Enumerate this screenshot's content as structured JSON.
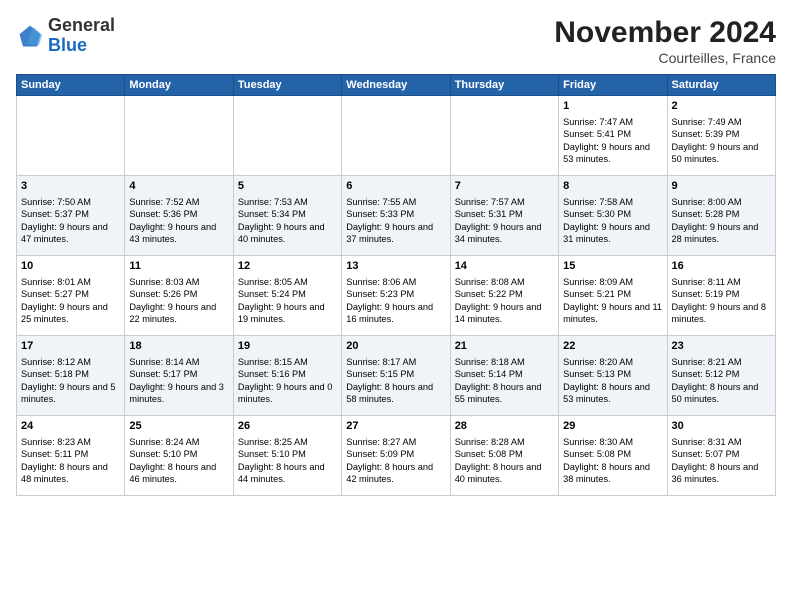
{
  "header": {
    "logo_general": "General",
    "logo_blue": "Blue",
    "month_title": "November 2024",
    "location": "Courteilles, France"
  },
  "weekdays": [
    "Sunday",
    "Monday",
    "Tuesday",
    "Wednesday",
    "Thursday",
    "Friday",
    "Saturday"
  ],
  "weeks": [
    [
      {
        "day": "",
        "info": ""
      },
      {
        "day": "",
        "info": ""
      },
      {
        "day": "",
        "info": ""
      },
      {
        "day": "",
        "info": ""
      },
      {
        "day": "",
        "info": ""
      },
      {
        "day": "1",
        "info": "Sunrise: 7:47 AM\nSunset: 5:41 PM\nDaylight: 9 hours and 53 minutes."
      },
      {
        "day": "2",
        "info": "Sunrise: 7:49 AM\nSunset: 5:39 PM\nDaylight: 9 hours and 50 minutes."
      }
    ],
    [
      {
        "day": "3",
        "info": "Sunrise: 7:50 AM\nSunset: 5:37 PM\nDaylight: 9 hours and 47 minutes."
      },
      {
        "day": "4",
        "info": "Sunrise: 7:52 AM\nSunset: 5:36 PM\nDaylight: 9 hours and 43 minutes."
      },
      {
        "day": "5",
        "info": "Sunrise: 7:53 AM\nSunset: 5:34 PM\nDaylight: 9 hours and 40 minutes."
      },
      {
        "day": "6",
        "info": "Sunrise: 7:55 AM\nSunset: 5:33 PM\nDaylight: 9 hours and 37 minutes."
      },
      {
        "day": "7",
        "info": "Sunrise: 7:57 AM\nSunset: 5:31 PM\nDaylight: 9 hours and 34 minutes."
      },
      {
        "day": "8",
        "info": "Sunrise: 7:58 AM\nSunset: 5:30 PM\nDaylight: 9 hours and 31 minutes."
      },
      {
        "day": "9",
        "info": "Sunrise: 8:00 AM\nSunset: 5:28 PM\nDaylight: 9 hours and 28 minutes."
      }
    ],
    [
      {
        "day": "10",
        "info": "Sunrise: 8:01 AM\nSunset: 5:27 PM\nDaylight: 9 hours and 25 minutes."
      },
      {
        "day": "11",
        "info": "Sunrise: 8:03 AM\nSunset: 5:26 PM\nDaylight: 9 hours and 22 minutes."
      },
      {
        "day": "12",
        "info": "Sunrise: 8:05 AM\nSunset: 5:24 PM\nDaylight: 9 hours and 19 minutes."
      },
      {
        "day": "13",
        "info": "Sunrise: 8:06 AM\nSunset: 5:23 PM\nDaylight: 9 hours and 16 minutes."
      },
      {
        "day": "14",
        "info": "Sunrise: 8:08 AM\nSunset: 5:22 PM\nDaylight: 9 hours and 14 minutes."
      },
      {
        "day": "15",
        "info": "Sunrise: 8:09 AM\nSunset: 5:21 PM\nDaylight: 9 hours and 11 minutes."
      },
      {
        "day": "16",
        "info": "Sunrise: 8:11 AM\nSunset: 5:19 PM\nDaylight: 9 hours and 8 minutes."
      }
    ],
    [
      {
        "day": "17",
        "info": "Sunrise: 8:12 AM\nSunset: 5:18 PM\nDaylight: 9 hours and 5 minutes."
      },
      {
        "day": "18",
        "info": "Sunrise: 8:14 AM\nSunset: 5:17 PM\nDaylight: 9 hours and 3 minutes."
      },
      {
        "day": "19",
        "info": "Sunrise: 8:15 AM\nSunset: 5:16 PM\nDaylight: 9 hours and 0 minutes."
      },
      {
        "day": "20",
        "info": "Sunrise: 8:17 AM\nSunset: 5:15 PM\nDaylight: 8 hours and 58 minutes."
      },
      {
        "day": "21",
        "info": "Sunrise: 8:18 AM\nSunset: 5:14 PM\nDaylight: 8 hours and 55 minutes."
      },
      {
        "day": "22",
        "info": "Sunrise: 8:20 AM\nSunset: 5:13 PM\nDaylight: 8 hours and 53 minutes."
      },
      {
        "day": "23",
        "info": "Sunrise: 8:21 AM\nSunset: 5:12 PM\nDaylight: 8 hours and 50 minutes."
      }
    ],
    [
      {
        "day": "24",
        "info": "Sunrise: 8:23 AM\nSunset: 5:11 PM\nDaylight: 8 hours and 48 minutes."
      },
      {
        "day": "25",
        "info": "Sunrise: 8:24 AM\nSunset: 5:10 PM\nDaylight: 8 hours and 46 minutes."
      },
      {
        "day": "26",
        "info": "Sunrise: 8:25 AM\nSunset: 5:10 PM\nDaylight: 8 hours and 44 minutes."
      },
      {
        "day": "27",
        "info": "Sunrise: 8:27 AM\nSunset: 5:09 PM\nDaylight: 8 hours and 42 minutes."
      },
      {
        "day": "28",
        "info": "Sunrise: 8:28 AM\nSunset: 5:08 PM\nDaylight: 8 hours and 40 minutes."
      },
      {
        "day": "29",
        "info": "Sunrise: 8:30 AM\nSunset: 5:08 PM\nDaylight: 8 hours and 38 minutes."
      },
      {
        "day": "30",
        "info": "Sunrise: 8:31 AM\nSunset: 5:07 PM\nDaylight: 8 hours and 36 minutes."
      }
    ]
  ]
}
